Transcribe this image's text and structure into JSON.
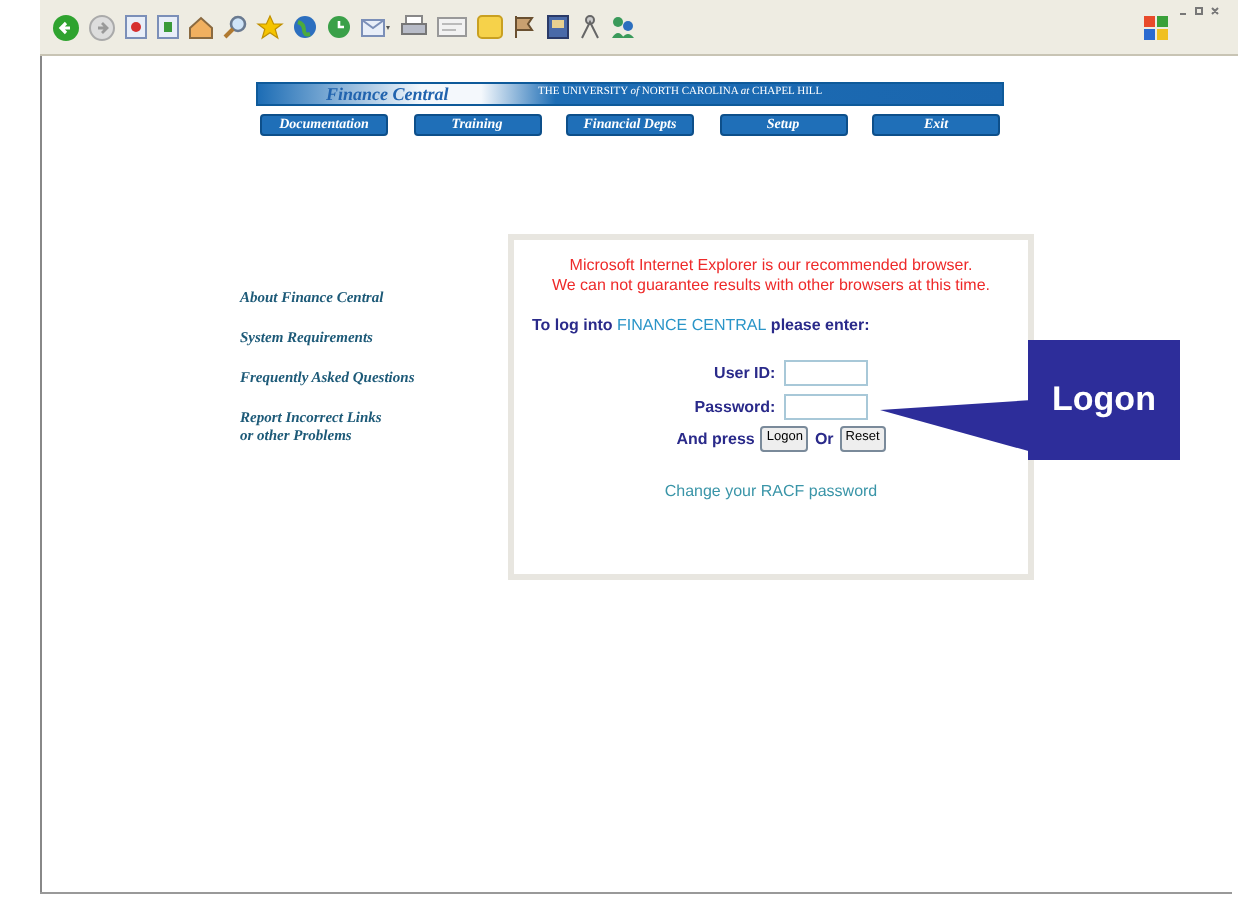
{
  "banner": {
    "title": "Finance Central",
    "subtitle": "THE UNIVERSITY *of* NORTH CAROLINA *at* CHAPEL HILL"
  },
  "nav": [
    "Documentation",
    "Training",
    "Financial Depts",
    "Setup",
    "Exit"
  ],
  "side_links": [
    "About Finance Central",
    "System Requirements",
    "Frequently Asked Questions",
    "Report Incorrect Links\nor other Problems"
  ],
  "login": {
    "notice": [
      "Microsoft Internet Explorer is our recommended browser.",
      "We can not guarantee results with other browsers at this time."
    ],
    "prompt": {
      "before": "To log into ",
      "highlight": "FINANCE CENTRAL",
      "after": " please enter:"
    },
    "fields": [
      {
        "label": "User ID:"
      },
      {
        "label": "Password:"
      }
    ],
    "press_label": "And press",
    "buttons": [
      "Logon",
      "Reset"
    ],
    "or_label": "Or",
    "change_link": "Change your RACF password"
  },
  "callout": {
    "text": "Logon"
  }
}
